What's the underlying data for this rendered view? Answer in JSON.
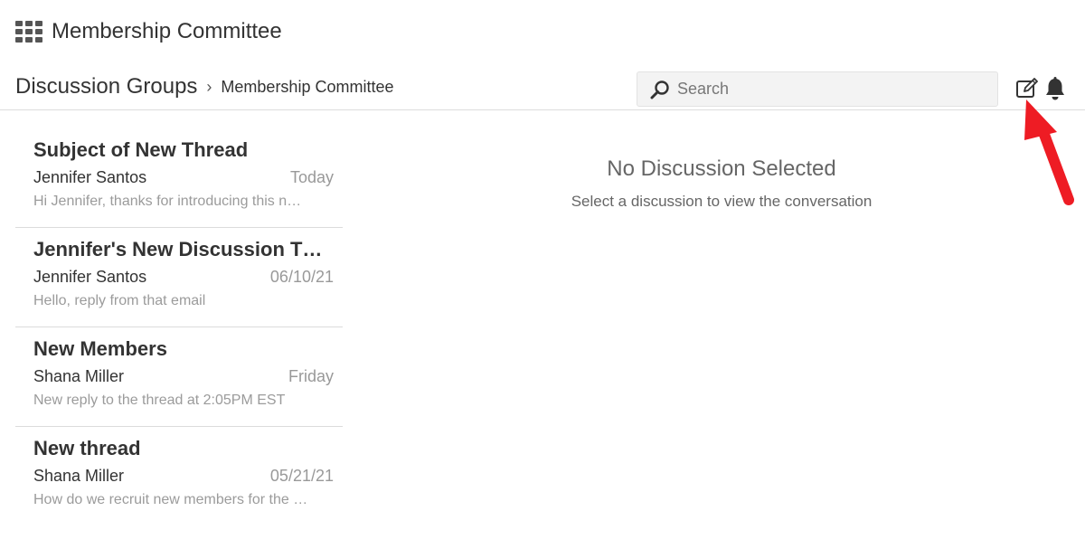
{
  "header": {
    "app_icon": "apps-grid-icon",
    "title": "Membership Committee"
  },
  "breadcrumb": {
    "root": "Discussion Groups",
    "separator": "›",
    "current": "Membership Committee"
  },
  "search": {
    "placeholder": "Search",
    "value": ""
  },
  "toolbar": {
    "compose_icon": "compose-icon",
    "notifications_icon": "bell-icon"
  },
  "threads": [
    {
      "subject": "Subject of New Thread",
      "author": "Jennifer Santos",
      "date": "Today",
      "preview": "Hi Jennifer, thanks for introducing this n…"
    },
    {
      "subject": "Jennifer's New Discussion T…",
      "author": "Jennifer Santos",
      "date": "06/10/21",
      "preview": "Hello, reply from that email"
    },
    {
      "subject": "New Members",
      "author": "Shana Miller",
      "date": "Friday",
      "preview": "New reply to the thread at 2:05PM EST"
    },
    {
      "subject": "New thread",
      "author": "Shana Miller",
      "date": "05/21/21",
      "preview": "How do we recruit new members for the …"
    }
  ],
  "empty_state": {
    "title": "No Discussion Selected",
    "subtitle": "Select a discussion to view the conversation"
  },
  "colors": {
    "annotation_arrow": "#ee1c24",
    "icon": "#333333",
    "muted_text": "#999999"
  }
}
